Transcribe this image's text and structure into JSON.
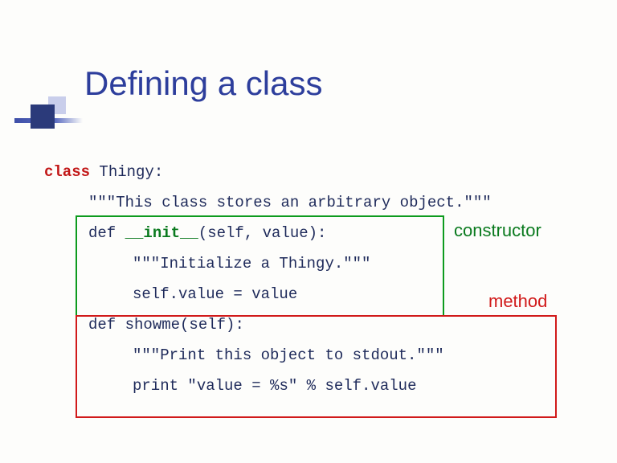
{
  "title": "Defining a class",
  "code": {
    "line1_kw": "class",
    "line1_rest": " Thingy:",
    "line2": "\"\"\"This class stores an arbitrary object.\"\"\"",
    "line3_def": "def ",
    "line3_init": "__init__",
    "line3_rest": "(self, value):",
    "line4": "\"\"\"Initialize a Thingy.\"\"\"",
    "line5": "self.value = value",
    "line6_def": "def",
    "line6_rest": " showme(self):",
    "line7": "\"\"\"Print this object to stdout.\"\"\"",
    "line8_print": "print ",
    "line8_rest": "\"value = %s\" % self.value"
  },
  "labels": {
    "constructor": "constructor",
    "method": "method"
  }
}
